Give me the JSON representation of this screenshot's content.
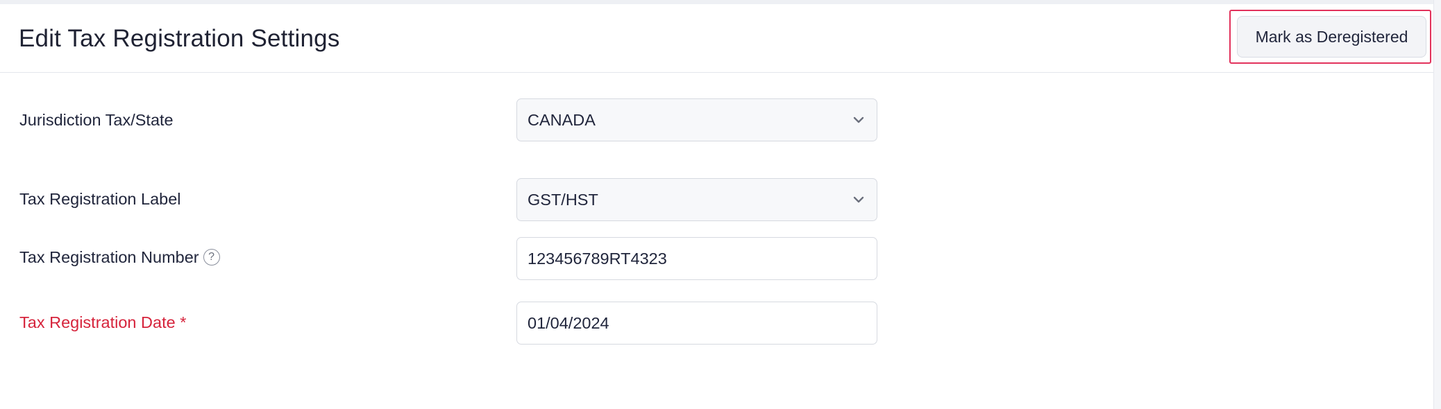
{
  "header": {
    "title": "Edit Tax Registration Settings",
    "deregister_label": "Mark as Deregistered"
  },
  "form": {
    "jurisdiction": {
      "label": "Jurisdiction Tax/State",
      "value": "CANADA"
    },
    "registration_label": {
      "label": "Tax Registration Label",
      "value": "GST/HST"
    },
    "registration_number": {
      "label": "Tax Registration Number",
      "help_glyph": "?",
      "value": "123456789RT4323"
    },
    "registration_date": {
      "label": "Tax Registration Date *",
      "value": "01/04/2024"
    }
  },
  "icons": {
    "chevron": "chevron-down-icon",
    "help": "question-circle-icon"
  },
  "colors": {
    "required_label": "#d6243c",
    "highlight": "#e2325c",
    "text": "#21263c"
  }
}
